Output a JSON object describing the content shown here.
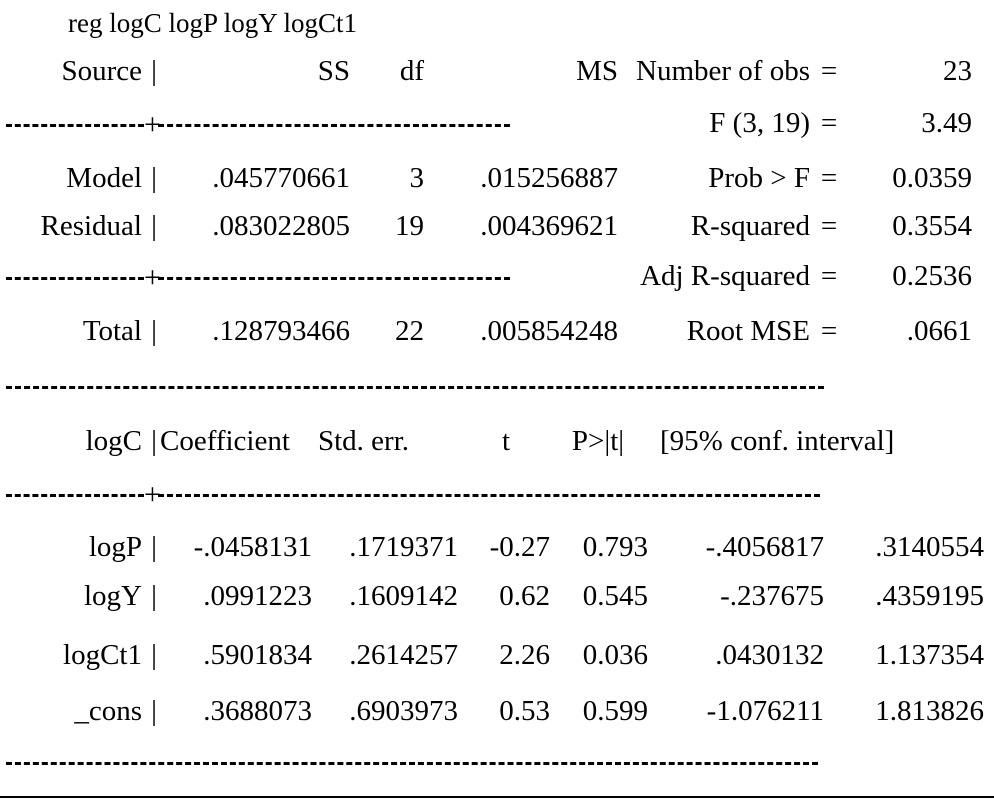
{
  "command": {
    "text": "reg logC logP logY logCt1"
  },
  "anova": {
    "headers": {
      "source": "Source",
      "divider": "|",
      "ss": "SS",
      "df": "df",
      "ms": "MS"
    },
    "rows": [
      {
        "label": "Model",
        "divider": "|",
        "ss": ".045770661",
        "df": "3",
        "ms": ".015256887"
      },
      {
        "label": "Residual",
        "divider": "|",
        "ss": ".083022805",
        "df": "19",
        "ms": ".004369621"
      },
      {
        "label": "Total",
        "divider": "|",
        "ss": ".128793466",
        "df": "22",
        "ms": ".005854248"
      }
    ]
  },
  "stats": [
    {
      "name": "Number of obs",
      "eq": "=",
      "value": "23"
    },
    {
      "name": "F (3, 19)",
      "eq": "=",
      "value": "3.49"
    },
    {
      "name": "Prob > F",
      "eq": "=",
      "value": "0.0359"
    },
    {
      "name": "R-squared",
      "eq": "=",
      "value": "0.3554"
    },
    {
      "name": "Adj R-squared",
      "eq": "=",
      "value": "0.2536"
    },
    {
      "name": "Root MSE",
      "eq": "=",
      "value": ".0661"
    }
  ],
  "coefficients": {
    "headers": {
      "depvar": "logC",
      "divider": "|",
      "coef": "Coefficient",
      "stderr": "Std. err.",
      "t": "t",
      "p": "P>|t|",
      "ci": "[95% conf. interval]"
    },
    "rows": [
      {
        "label": "logP",
        "divider": "|",
        "coef": "-.0458131",
        "stderr": ".1719371",
        "t": "-0.27",
        "p": "0.793",
        "ci_low": "-.4056817",
        "ci_high": ".3140554"
      },
      {
        "label": "logY",
        "divider": "|",
        "coef": ".0991223",
        "stderr": ".1609142",
        "t": "0.62",
        "p": "0.545",
        "ci_low": "-.237675",
        "ci_high": ".4359195"
      },
      {
        "label": "logCt1",
        "divider": "|",
        "coef": ".5901834",
        "stderr": ".2614257",
        "t": "2.26",
        "p": "0.036",
        "ci_low": ".0430132",
        "ci_high": "1.137354"
      },
      {
        "label": "_cons",
        "divider": "|",
        "coef": ".3688073",
        "stderr": ".6903973",
        "t": "0.53",
        "p": "0.599",
        "ci_low": "-1.076211",
        "ci_high": "1.813826"
      }
    ]
  },
  "separators": {
    "plus": "+"
  },
  "colors": {
    "text": "#000000",
    "background": "#ffffff"
  }
}
